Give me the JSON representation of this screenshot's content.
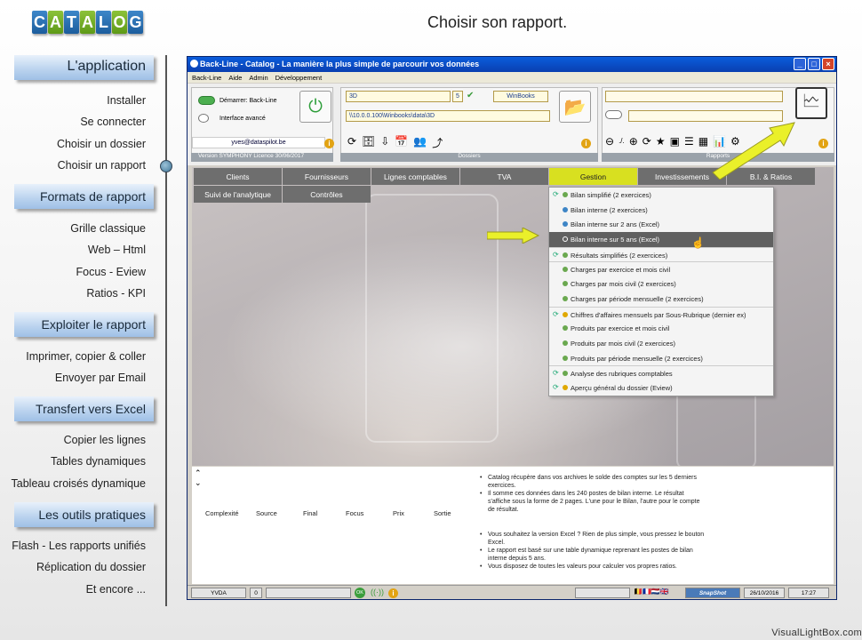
{
  "logo": {
    "letters": [
      "C",
      "A",
      "T",
      "A",
      "L",
      "O",
      "G"
    ]
  },
  "page_title": "Choisir son rapport.",
  "nav": {
    "sections": [
      {
        "title": "L'application",
        "items": [
          "Installer",
          "Se connecter",
          "Choisir un dossier",
          "Choisir un rapport"
        ]
      },
      {
        "title": "Formats de rapport",
        "items": [
          "Grille classique",
          "Web – Html",
          "Focus - Eview",
          "Ratios - KPI"
        ]
      },
      {
        "title": "Exploiter le rapport",
        "items": [
          "Imprimer, copier & coller",
          "Envoyer par Email"
        ]
      },
      {
        "title": "Transfert vers Excel",
        "items": [
          "Copier les lignes",
          "Tables dynamiques",
          "Tableau croisés dynamique"
        ]
      },
      {
        "title": "Les outils pratiques",
        "items": [
          "Flash - Les rapports unifiés",
          "Réplication du dossier",
          "Et encore ..."
        ]
      }
    ]
  },
  "window": {
    "title": "Back-Line - Catalog - La manière la plus simple de parcourir vos données",
    "menu": [
      "Back-Line",
      "Aide",
      "Admin",
      "Développement"
    ],
    "demarrer_label": "Démarrer: Back-Line",
    "interface_label": "Interface avancé",
    "email": "yves@dataspilot.be",
    "version": "Version  SYMPHONY  Licence 30/06/2017",
    "dossier_field": "3D",
    "dossier_num": "5",
    "software": "WinBooks",
    "path": "\\\\10.0.0.100\\Winbooks\\data\\3D",
    "dossiers_label": "Dossiers",
    "rapports_label": "Rapports",
    "nav_text": "./."
  },
  "tabs": [
    "Clients",
    "Fournisseurs",
    "Lignes comptables",
    "TVA",
    "Gestion",
    "Investissements",
    "B.I. & Ratios",
    "Suivi de l'analytique",
    "Contrôles"
  ],
  "dropdown": [
    {
      "label": "Bilan simplifié (2 exercices)",
      "color": "#6aa84f",
      "refresh": true,
      "sep": false,
      "highlight": false
    },
    {
      "label": "Bilan interne (2 exercices)",
      "color": "#3d85c6",
      "refresh": false,
      "sep": false,
      "highlight": false
    },
    {
      "label": "Bilan interne sur 2 ans (Excel)",
      "color": "#3d85c6",
      "refresh": false,
      "sep": false,
      "highlight": false
    },
    {
      "label": "Bilan interne sur 5 ans (Excel)",
      "color": "#3d85c6",
      "refresh": false,
      "sep": false,
      "highlight": true
    },
    {
      "label": "Résultats simplifiés (2 exercices)",
      "color": "#6aa84f",
      "refresh": true,
      "sep": true,
      "highlight": false
    },
    {
      "label": "Charges par exercice et mois civil",
      "color": "#6aa84f",
      "refresh": false,
      "sep": true,
      "highlight": false
    },
    {
      "label": "Charges par mois civil (2 exercices)",
      "color": "#6aa84f",
      "refresh": false,
      "sep": false,
      "highlight": false
    },
    {
      "label": "Charges par période mensuelle (2 exercices)",
      "color": "#6aa84f",
      "refresh": false,
      "sep": false,
      "highlight": false
    },
    {
      "label": "Chiffres d'affaires mensuels par Sous-Rubrique (dernier ex)",
      "color": "#e0a800",
      "refresh": true,
      "sep": true,
      "highlight": false
    },
    {
      "label": "Produits par exercice et mois civil",
      "color": "#6aa84f",
      "refresh": false,
      "sep": false,
      "highlight": false
    },
    {
      "label": "Produits par mois civil (2 exercices)",
      "color": "#6aa84f",
      "refresh": false,
      "sep": false,
      "highlight": false
    },
    {
      "label": "Produits par période mensuelle (2 exercices)",
      "color": "#6aa84f",
      "refresh": false,
      "sep": false,
      "highlight": false
    },
    {
      "label": "Analyse des rubriques comptables",
      "color": "#6aa84f",
      "refresh": true,
      "sep": true,
      "highlight": false
    },
    {
      "label": "Aperçu général du dossier (Eview)",
      "color": "#e0a800",
      "refresh": true,
      "sep": false,
      "highlight": false
    }
  ],
  "bottom": {
    "headers": [
      "Complexité",
      "Source",
      "Final",
      "Focus",
      "Prix",
      "Sortie"
    ],
    "bullets_a": [
      "Catalog récupère dans vos archives le solde des comptes sur les 5 derniers exercices.",
      "Il somme ces données dans les 240 postes de bilan interne. Le résultat s'affiche sous la forme de 2 pages. L'une pour le Bilan, l'autre pour le compte de résultat."
    ],
    "bullets_b": [
      "Vous souhaitez la version Excel ? Rien de plus simple, vous pressez le bouton Excel.",
      "Le rapport est basé sur une table dynamique reprenant les postes de bilan interne depuis 5 ans.",
      "Vous disposez de toutes les valeurs pour calculer vos propres ratios."
    ]
  },
  "statusbar": {
    "user": "YVDA",
    "count": "0",
    "ok": "OK",
    "brand": "SnapShot",
    "date": "26/10/2016",
    "time": "17:27"
  },
  "watermark": "VisualLightBox.com",
  "colors": {
    "accent_tab": "#d8e020",
    "arrow": "#eaf02a"
  }
}
